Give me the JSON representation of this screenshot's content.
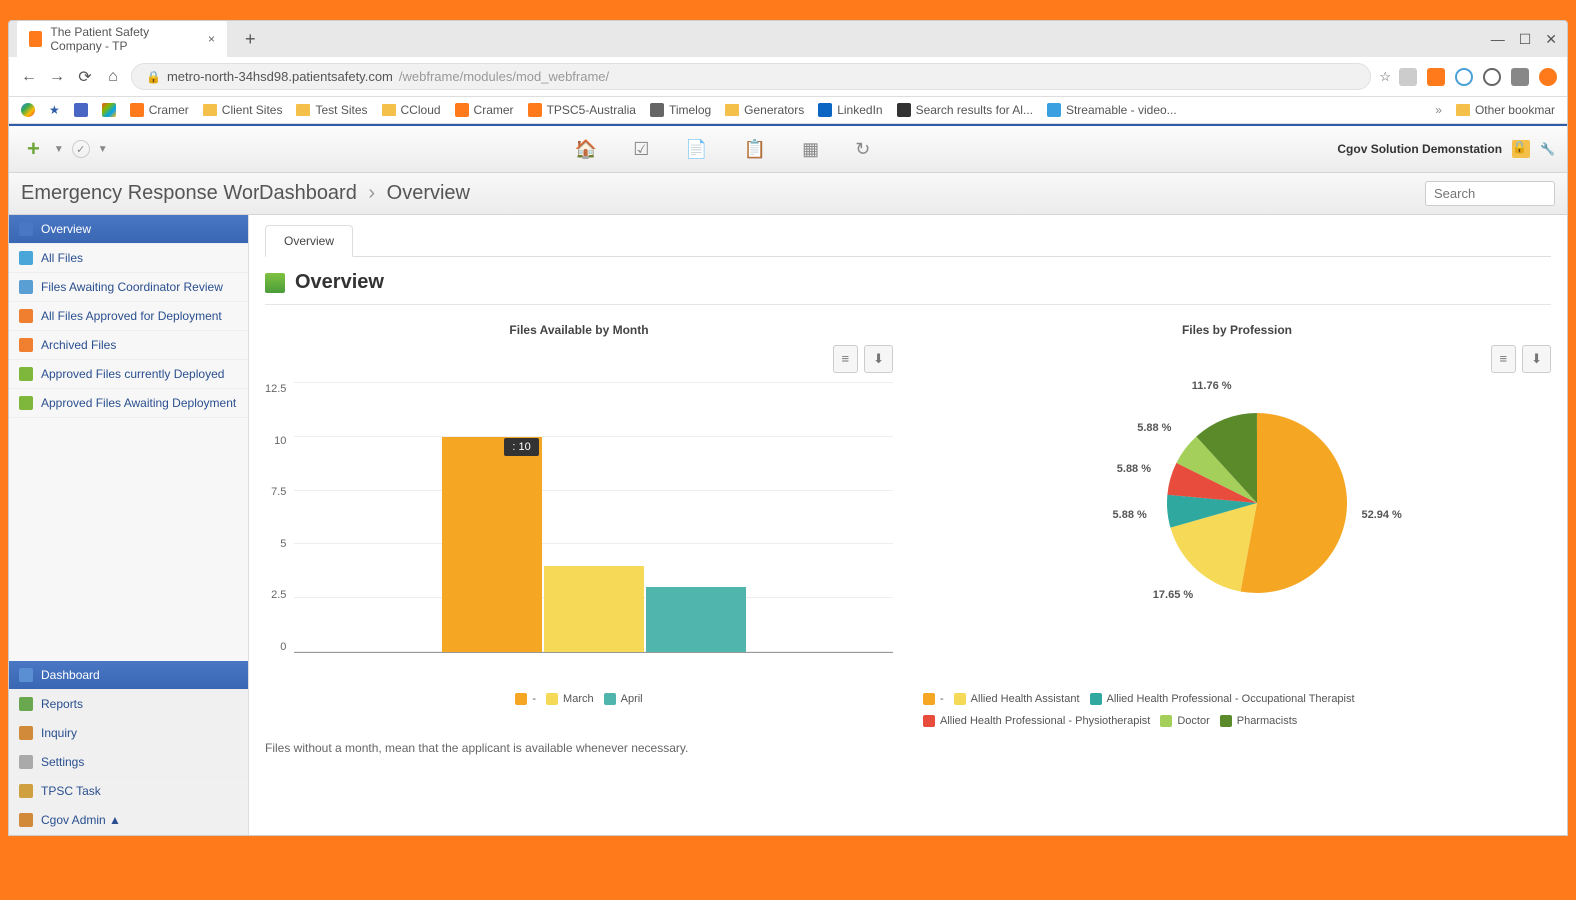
{
  "browser": {
    "tab_title": "The Patient Safety Company - TP",
    "url_host": "metro-north-34hsd98.patientsafety.com",
    "url_path": "/webframe/modules/mod_webframe/",
    "bookmarks": [
      "Cramer",
      "Client Sites",
      "Test Sites",
      "CCloud",
      "Cramer",
      "TPSC5-Australia",
      "Timelog",
      "Generators",
      "LinkedIn",
      "Search results for Al...",
      "Streamable - video..."
    ],
    "other_bookmarks": "Other bookmar"
  },
  "app": {
    "user_label": "Cgov Solution Demonstation",
    "workspace_title": "Emergency Response Work",
    "breadcrumb": [
      "Dashboard",
      "Overview"
    ],
    "search_placeholder": "Search"
  },
  "sidebar_top": [
    {
      "label": "Overview",
      "active": true,
      "color": "#4a77c4"
    },
    {
      "label": "All Files",
      "color": "#4aa5d8"
    },
    {
      "label": "Files Awaiting Coordinator Review",
      "color": "#5a9fd4"
    },
    {
      "label": "All Files Approved for Deployment",
      "color": "#f08030"
    },
    {
      "label": "Archived Files",
      "color": "#f08030"
    },
    {
      "label": "Approved Files currently Deployed",
      "color": "#7fb63c"
    },
    {
      "label": "Approved Files Awaiting Deployment",
      "color": "#7fb63c"
    }
  ],
  "sidebar_bottom": [
    {
      "label": "Dashboard",
      "active": true,
      "color": "#5a8fd4"
    },
    {
      "label": "Reports",
      "color": "#6aa84f"
    },
    {
      "label": "Inquiry",
      "color": "#d08a3a"
    },
    {
      "label": "Settings",
      "color": "#aaa"
    },
    {
      "label": "TPSC Task",
      "color": "#d0a040"
    },
    {
      "label": "Cgov Admin ▲",
      "color": "#d08a3a"
    }
  ],
  "page": {
    "tab": "Overview",
    "title": "Overview",
    "note": "Files without a month, mean that the applicant is available whenever necessary."
  },
  "chart_data": [
    {
      "type": "bar",
      "title": "Files Available by Month",
      "categories": [
        "-",
        "March",
        "April"
      ],
      "values": [
        10,
        4,
        3
      ],
      "colors": [
        "#f5a623",
        "#f5d957",
        "#4fb5ad"
      ],
      "ylim": [
        0,
        12.5
      ],
      "yticks": [
        0,
        2.5,
        5,
        7.5,
        10,
        12.5
      ],
      "tooltip": ": 10"
    },
    {
      "type": "pie",
      "title": "Files by Profession",
      "series": [
        {
          "name": "-",
          "value": 52.94,
          "color": "#f5a623"
        },
        {
          "name": "Allied Health Assistant",
          "value": 17.65,
          "color": "#f5d957"
        },
        {
          "name": "Allied Health Professional - Occupational Therapist",
          "value": 5.88,
          "color": "#2fa8a0"
        },
        {
          "name": "Allied Health Professional - Physiotherapist",
          "value": 5.88,
          "color": "#e74c3c"
        },
        {
          "name": "Doctor",
          "value": 5.88,
          "color": "#a3cf5a"
        },
        {
          "name": "Pharmacists",
          "value": 11.76,
          "color": "#5a8a2a"
        }
      ]
    }
  ]
}
